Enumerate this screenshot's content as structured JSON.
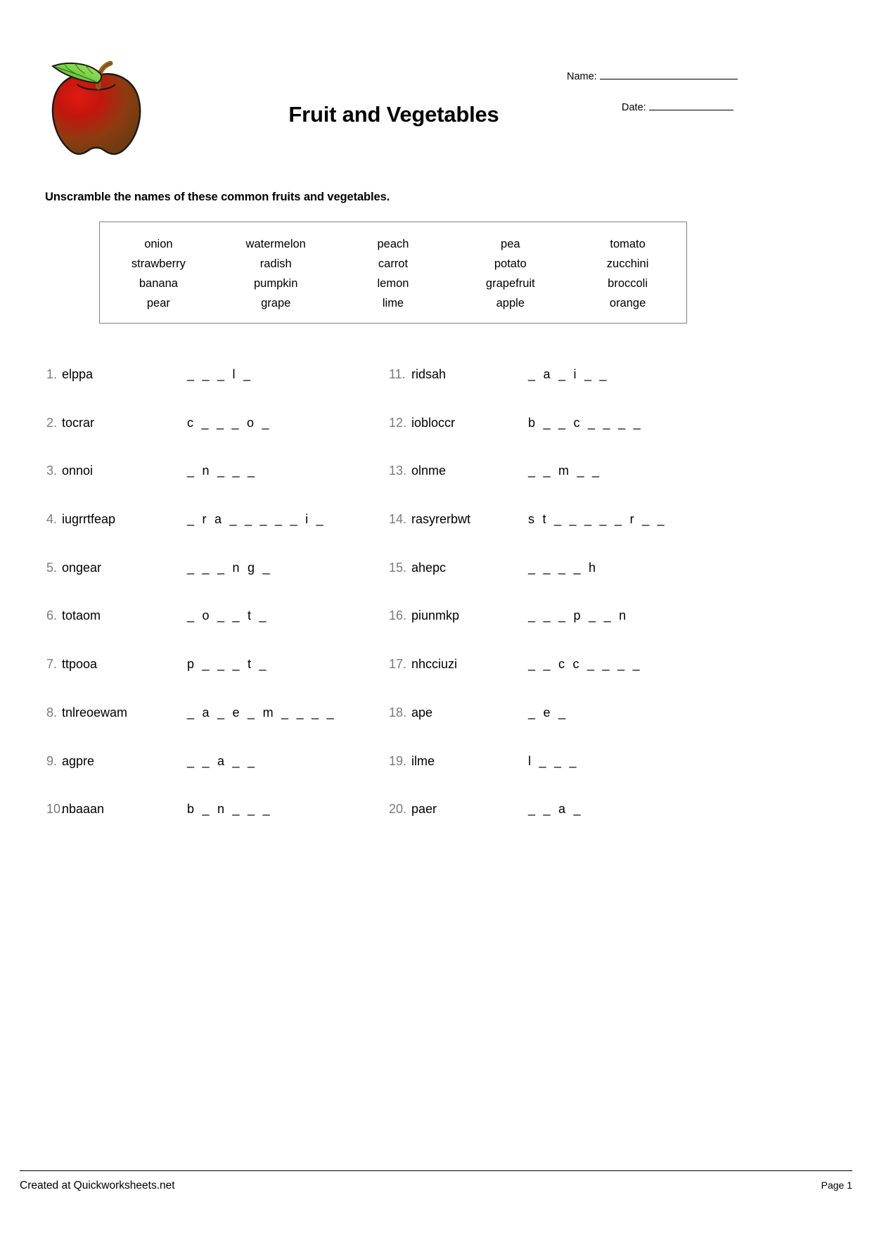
{
  "header": {
    "title": "Fruit and Vegetables",
    "name_label": "Name:",
    "date_label": "Date:",
    "logo_icon": "apple-icon"
  },
  "instructions": "Unscramble the names of these common fruits and vegetables.",
  "word_bank": {
    "words": [
      "onion",
      "watermelon",
      "peach",
      "pea",
      "tomato",
      "strawberry",
      "radish",
      "carrot",
      "potato",
      "zucchini",
      "banana",
      "pumpkin",
      "lemon",
      "grapefruit",
      "broccoli",
      "pear",
      "grape",
      "lime",
      "apple",
      "orange"
    ]
  },
  "items": {
    "left": [
      {
        "number": "1.",
        "scrambled": "elppa",
        "pattern": "_  _  _  l  _"
      },
      {
        "number": "2.",
        "scrambled": "tocrar",
        "pattern": "c  _  _  _  o  _"
      },
      {
        "number": "3.",
        "scrambled": "onnoi",
        "pattern": "_  n  _  _  _"
      },
      {
        "number": "4.",
        "scrambled": "iugrrtfeap",
        "pattern": "_  r  a  _  _  _  _  _  i  _"
      },
      {
        "number": "5.",
        "scrambled": "ongear",
        "pattern": "_  _  _  n  g  _"
      },
      {
        "number": "6.",
        "scrambled": "totaom",
        "pattern": "_  o  _  _  t  _"
      },
      {
        "number": "7.",
        "scrambled": "ttpooa",
        "pattern": "p  _  _  _  t  _"
      },
      {
        "number": "8.",
        "scrambled": "tnlreoewam",
        "pattern": "_  a  _  e  _  m  _  _  _  _"
      },
      {
        "number": "9.",
        "scrambled": "agpre",
        "pattern": "_  _  a  _  _"
      },
      {
        "number": "10.",
        "scrambled": "nbaaan",
        "pattern": "b  _  n  _  _  _"
      }
    ],
    "right": [
      {
        "number": "11.",
        "scrambled": "ridsah",
        "pattern": "_  a  _  i  _  _"
      },
      {
        "number": "12.",
        "scrambled": "iobloccr",
        "pattern": "b  _  _  c  _  _  _  _"
      },
      {
        "number": "13.",
        "scrambled": "olnme",
        "pattern": "_  _  m  _  _"
      },
      {
        "number": "14.",
        "scrambled": "rasyrerbwt",
        "pattern": "s  t  _  _  _  _  _  r  _  _"
      },
      {
        "number": "15.",
        "scrambled": "ahepc",
        "pattern": "_  _  _  _  h"
      },
      {
        "number": "16.",
        "scrambled": "piunmkp",
        "pattern": "_  _  _  p  _  _  n"
      },
      {
        "number": "17.",
        "scrambled": "nhcciuzi",
        "pattern": "_  _  c  c  _  _  _  _"
      },
      {
        "number": "18.",
        "scrambled": "ape",
        "pattern": "_  e  _"
      },
      {
        "number": "19.",
        "scrambled": "ilme",
        "pattern": "l  _  _  _"
      },
      {
        "number": "20.",
        "scrambled": "paer",
        "pattern": "_  _  a  _"
      }
    ]
  },
  "footer": {
    "credit": "Created at Quickworksheets.net",
    "page": "Page 1"
  }
}
